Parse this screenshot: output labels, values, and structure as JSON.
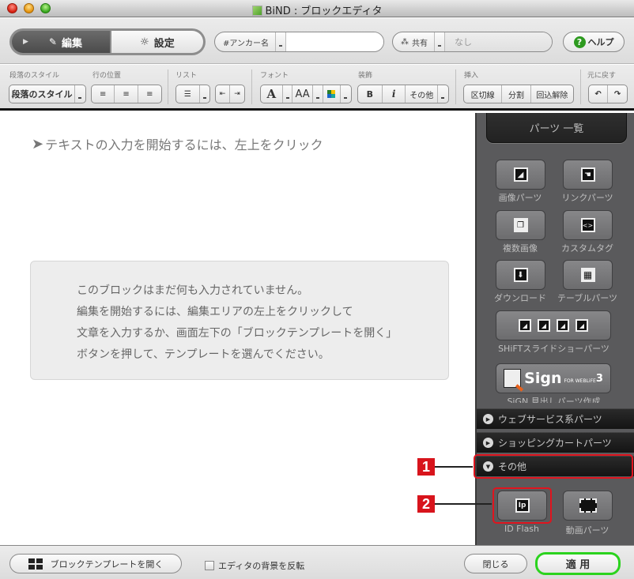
{
  "window": {
    "title": "BiND : ブロックエディタ"
  },
  "toolbar": {
    "edit_label": "編集",
    "settings_label": "設定",
    "anchor_label": "#アンカー名",
    "anchor_value": "",
    "share_label": "共有",
    "share_value": "なし",
    "help_label": "ヘルプ"
  },
  "format_toolbar": {
    "groups": {
      "paragraph_style": "段落のスタイル",
      "line_position": "行の位置",
      "list": "リスト",
      "font": "フォント",
      "decoration": "装飾",
      "insert": "挿入",
      "undo": "元に戻す"
    },
    "paragraph_style_button": "段落のスタイル",
    "font_button": "A",
    "font_size_button": "AA",
    "bold_button": "B",
    "italic_button": "i",
    "other_button": "その他",
    "insert_buttons": [
      "区切線",
      "分割",
      "回込解除"
    ]
  },
  "editor": {
    "hint": "テキストの入力を開始するには、左上をクリック",
    "empty_message": [
      "このブロックはまだ何も入力されていません。",
      "編集を開始するには、編集エリアの左上をクリックして",
      "文章を入力するか、画面左下の「ブロックテンプレートを開く」",
      "ボタンを押して、テンプレートを選んでください。"
    ]
  },
  "parts_panel": {
    "title": "パーツ 一覧",
    "parts": [
      {
        "label": "画像パーツ",
        "icon": "image-icon"
      },
      {
        "label": "リンクパーツ",
        "icon": "link-hand-icon"
      },
      {
        "label": "複数画像",
        "icon": "multi-image-icon"
      },
      {
        "label": "カスタムタグ",
        "icon": "code-tag-icon"
      },
      {
        "label": "ダウンロード",
        "icon": "download-icon"
      },
      {
        "label": "テーブルパーツ",
        "icon": "table-icon"
      },
      {
        "label": "SHiFTスライドショーパーツ",
        "icon": "slideshow-icon"
      },
      {
        "label": "SiGN 見出しパーツ作成",
        "icon": "sign-icon",
        "logo_text": "Sign",
        "logo_sub": "FOR WEBLiFE",
        "logo_num": "3"
      }
    ],
    "sections": [
      {
        "label": "ウェブサービス系パーツ",
        "expanded": false
      },
      {
        "label": "ショッピングカートパーツ",
        "expanded": false
      },
      {
        "label": "その他",
        "expanded": true
      }
    ],
    "other_parts": [
      {
        "label": "ID Flash",
        "icon": "id-flash-icon"
      },
      {
        "label": "動画パーツ",
        "icon": "video-icon"
      }
    ]
  },
  "callouts": [
    "1",
    "2"
  ],
  "bottom": {
    "open_template_label": "ブロックテンプレートを開く",
    "invert_bg_label": "エディタの背景を反転",
    "close_label": "閉じる",
    "apply_label": "適 用"
  },
  "colors": {
    "highlight": "#e0141e",
    "apply_border": "#2bd31e",
    "help_icon": "#2d9a1f"
  }
}
